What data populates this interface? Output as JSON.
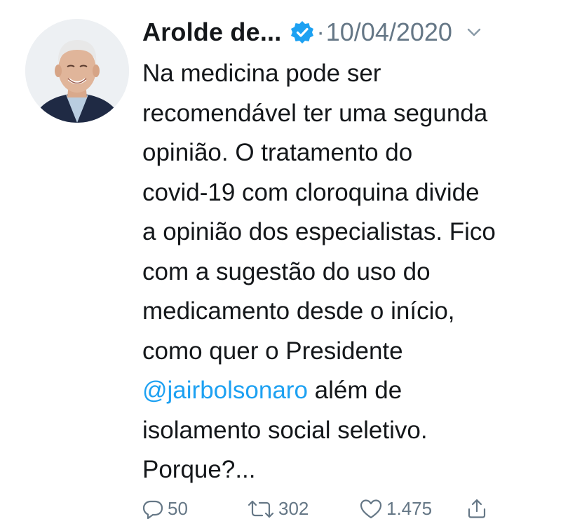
{
  "tweet": {
    "display_name": "Arolde de...",
    "separator": "·",
    "timestamp": "10/04/2020",
    "body_lines": [
      "Na medicina pode ser",
      "recomendável ter uma segunda",
      "opinião. O tratamento do",
      "covid-19 com cloroquina divide",
      "a opinião dos especialistas. Fico",
      "com a sugestão do uso do",
      "medicamento desde o início,",
      "como quer o Presidente"
    ],
    "mention": "@jairbolsonaro",
    "mention_suffix": " além de",
    "body_lines_after": [
      "isolamento social seletivo.",
      "Porque?..."
    ],
    "actions": {
      "reply_count": "50",
      "retweet_count": "302",
      "like_count": "1.475"
    }
  },
  "icons": {
    "verified": "verified-badge-icon",
    "chevron": "chevron-down-icon",
    "reply": "reply-icon",
    "retweet": "retweet-icon",
    "like": "heart-icon",
    "share": "share-icon"
  },
  "colors": {
    "accent": "#1da1f2",
    "text": "#14171a",
    "muted": "#657786"
  }
}
